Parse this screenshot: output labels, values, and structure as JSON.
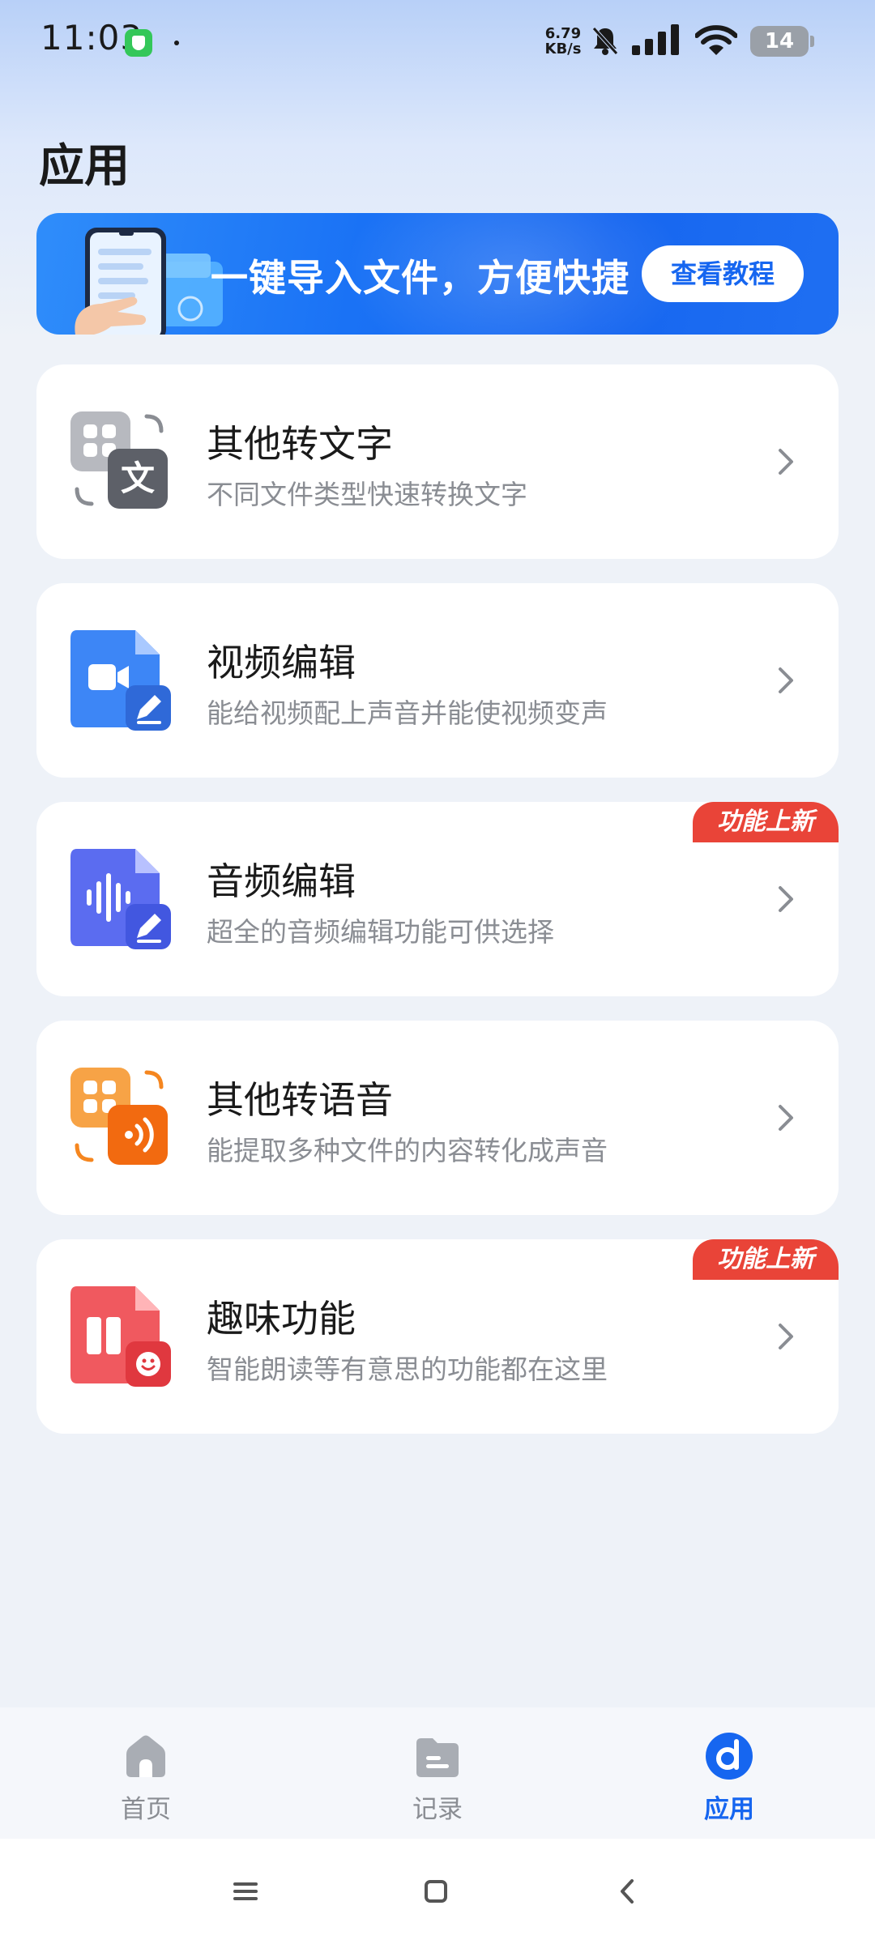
{
  "status_bar": {
    "time": "11:03",
    "net_speed_value": "6.79",
    "net_speed_unit": "KB/s",
    "battery_level": "14"
  },
  "page": {
    "title": "应用"
  },
  "banner": {
    "text": "一键导入文件，方便快捷",
    "button_label": "查看教程",
    "color": "#1666f0"
  },
  "cards": [
    {
      "title": "其他转文字",
      "description": "不同文件类型快速转换文字",
      "icon": "file-to-text-icon",
      "badge": ""
    },
    {
      "title": "视频编辑",
      "description": "能给视频配上声音并能使视频变声",
      "icon": "video-edit-icon",
      "badge": ""
    },
    {
      "title": "音频编辑",
      "description": "超全的音频编辑功能可供选择",
      "icon": "audio-edit-icon",
      "badge": "功能上新"
    },
    {
      "title": "其他转语音",
      "description": "能提取多种文件的内容转化成声音",
      "icon": "file-to-speech-icon",
      "badge": ""
    },
    {
      "title": "趣味功能",
      "description": "智能朗读等有意思的功能都在这里",
      "icon": "fun-features-icon",
      "badge": "功能上新"
    }
  ],
  "bottom_nav": {
    "items": [
      {
        "label": "首页",
        "icon": "home-icon",
        "active": false
      },
      {
        "label": "记录",
        "icon": "records-icon",
        "active": false
      },
      {
        "label": "应用",
        "icon": "apps-icon",
        "active": true
      }
    ],
    "active_color": "#1666f0"
  },
  "system_nav": {
    "buttons": [
      "menu-icon",
      "home-square-icon",
      "back-icon"
    ]
  }
}
